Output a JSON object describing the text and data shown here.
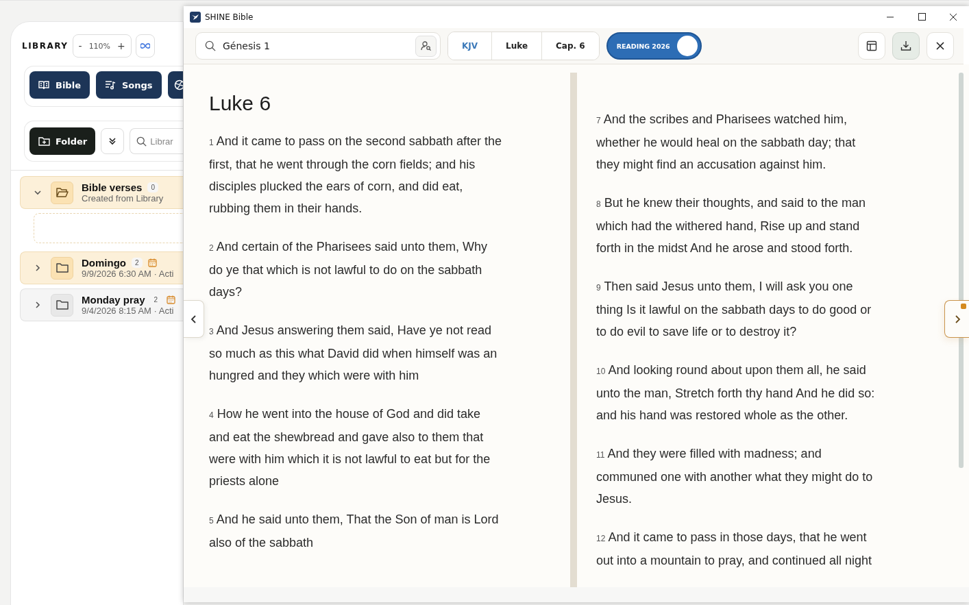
{
  "library": {
    "title": "LIBRARY",
    "zoom_minus": "-",
    "zoom": "110%",
    "zoom_plus": "+"
  },
  "modes": [
    {
      "kind": "bible",
      "label": "Bible"
    },
    {
      "kind": "songs",
      "label": "Songs"
    },
    {
      "kind": "globe"
    }
  ],
  "folder_button": "Folder",
  "search_placeholder": "Librar",
  "folders": [
    {
      "name": "Bible verses",
      "count": "0",
      "subtitle": "Created from Library",
      "expanded": true,
      "scheduled": false,
      "highlighted": true
    },
    {
      "name": "Domingo",
      "count": "2",
      "subtitle": "9/9/2026 6:30 AM · Acti",
      "expanded": false,
      "scheduled": true,
      "highlighted": true
    },
    {
      "name": "Monday pray",
      "count": "2",
      "subtitle": "9/4/2026 8:15 AM · Acti",
      "expanded": false,
      "scheduled": true,
      "highlighted": false
    }
  ],
  "window": {
    "title": "SHINE Bible"
  },
  "search": {
    "value": "Génesis 1"
  },
  "selectors": [
    {
      "label": "KJV",
      "selected": true
    },
    {
      "label": "Luke",
      "selected": false
    },
    {
      "label": "Cap. 6",
      "selected": false
    }
  ],
  "reading_toggle": {
    "label": "READING 2026",
    "on": true
  },
  "chapter_title": "Luke 6",
  "columns": [
    [
      {
        "number": "1",
        "text": "And it came to pass on the second sabbath after the first, that he went through the corn fields; and his disciples plucked the ears of corn, and did eat, rubbing them in their hands."
      },
      {
        "number": "2",
        "text": "And certain of the Pharisees said unto them, Why do ye that which is not lawful to do on the sabbath days?"
      },
      {
        "number": "3",
        "text": "And Jesus answering them said, Have ye not read so much as this what David did when himself was an hungred and they which were with him"
      },
      {
        "number": "4",
        "text": "How he went into the house of God and did take and eat the shewbread and gave also to them that were with him which it is not lawful to eat but for the priests alone"
      },
      {
        "number": "5",
        "text": "And he said unto them, That the Son of man is Lord also of the sabbath"
      }
    ],
    [
      {
        "number": "7",
        "text": "And the scribes and Pharisees watched him, whether he would heal on the sabbath day; that they might find an accusation against him."
      },
      {
        "number": "8",
        "text": "But he knew their thoughts, and said to the man which had the withered hand, Rise up and stand forth in the midst And he arose and stood forth."
      },
      {
        "number": "9",
        "text": "Then said Jesus unto them, I will ask you one thing Is it lawful on the sabbath days to do good or to do evil to save life or to destroy it?"
      },
      {
        "number": "10",
        "text": "And looking round about upon them all, he said unto the man, Stretch forth thy hand And he did so: and his hand was restored whole as the other."
      },
      {
        "number": "11",
        "text": "And they were filled with madness; and communed one with another what they might do to Jesus."
      },
      {
        "number": "12",
        "text": "And it came to pass in those days, that he went out into a mountain to pray, and continued all night"
      }
    ]
  ]
}
